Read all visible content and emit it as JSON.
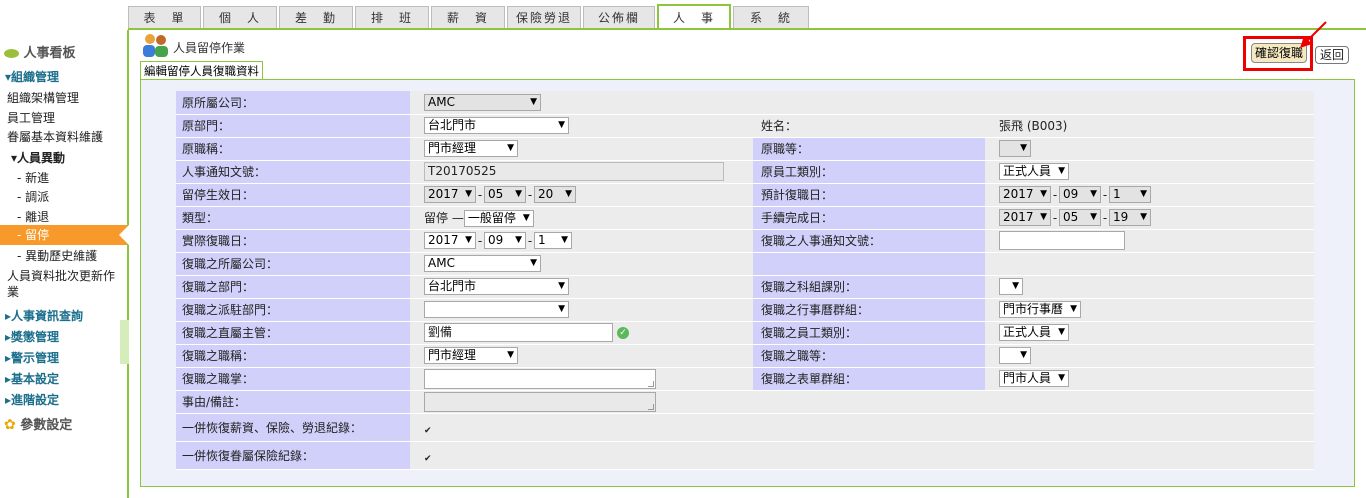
{
  "top_tabs": [
    "表　單",
    "個　人",
    "差　勤",
    "排　班",
    "薪　資",
    "保險勞退",
    "公佈欄",
    "人　事",
    "系　統"
  ],
  "sidebar": {
    "dashboard": "人事看板",
    "org": "▾組織管理",
    "org_items": [
      "組織架構管理",
      "員工管理",
      "眷屬基本資料維護"
    ],
    "personnel": "▾人員異動",
    "personnel_items": [
      "- 新進",
      "- 調派",
      "- 離退",
      "- 留停",
      "- 異動歷史維護"
    ],
    "batch1": "人員資料批次更新作",
    "batch2": "業",
    "groups": [
      "▸人事資訊查詢",
      "▸獎懲管理",
      "▸警示管理",
      "▸基本設定",
      "▸進階設定"
    ],
    "params": "參數設定"
  },
  "page": {
    "title": "人員留停作業",
    "subtab": "編輯留停人員復職資料",
    "confirm": "確認復職",
    "back": "返回"
  },
  "form": {
    "orig_company_label": "原所屬公司：",
    "orig_company": "AMC",
    "orig_dept_label": "原部門：",
    "orig_dept": "台北門市",
    "name_label": "姓名：",
    "name": "張飛 (B003)",
    "orig_title_label": "原職稱：",
    "orig_title": "門市經理",
    "orig_grade_label": "原職等：",
    "orig_grade": "",
    "notice_no_label": "人事通知文號：",
    "notice_no": "T20170525",
    "orig_emp_type_label": "原員工類別：",
    "orig_emp_type": "正式人員",
    "suspend_date_label": "留停生效日：",
    "suspend_y": "2017",
    "suspend_m": "05",
    "suspend_d": "20",
    "exp_return_label": "預計復職日：",
    "exp_y": "2017",
    "exp_m": "09",
    "exp_d": "1",
    "type_label": "類型：",
    "type_prefix": "留停 —",
    "type_value": "一般留停",
    "done_date_label": "手續完成日：",
    "done_y": "2017",
    "done_m": "05",
    "done_d": "19",
    "actual_return_label": "實際復職日：",
    "act_y": "2017",
    "act_m": "09",
    "act_d": "1",
    "ret_notice_label": "復職之人事通知文號：",
    "ret_notice": "",
    "ret_company_label": "復職之所屬公司：",
    "ret_company": "AMC",
    "ret_dept_label": "復職之部門：",
    "ret_dept": "台北門市",
    "ret_section_label": "復職之科組課別：",
    "ret_section": "",
    "ret_branch_label": "復職之派駐部門：",
    "ret_branch": "",
    "ret_calendar_label": "復職之行事曆群組：",
    "ret_calendar": "門市行事曆",
    "ret_manager_label": "復職之直屬主管：",
    "ret_manager": "劉備",
    "ret_emp_type_label": "復職之員工類別：",
    "ret_emp_type": "正式人員",
    "ret_title_label": "復職之職稱：",
    "ret_title": "門市經理",
    "ret_grade_label": "復職之職等：",
    "ret_grade": "",
    "ret_duty_label": "復職之職掌：",
    "ret_form_group_label": "復職之表單群組：",
    "ret_form_group": "門市人員",
    "remark_label": "事由/備註：",
    "restore_salary_label": "一併恢復薪資、保險、勞退紀錄：",
    "restore_family_label": "一併恢復眷屬保險紀錄："
  }
}
